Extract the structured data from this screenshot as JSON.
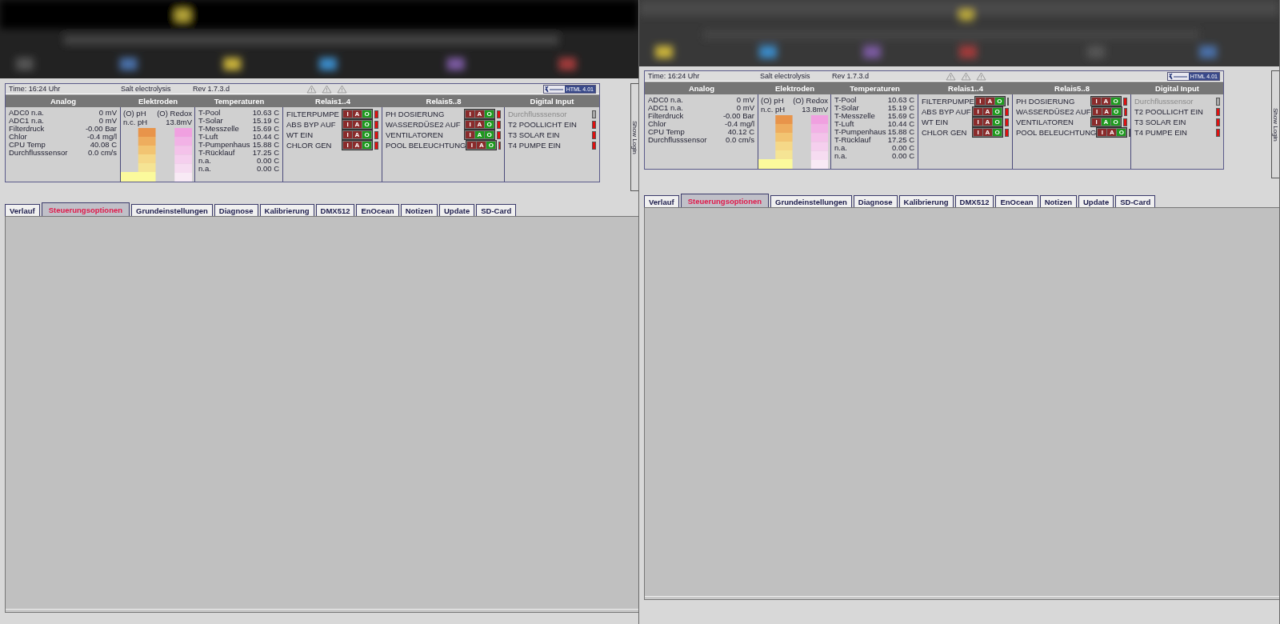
{
  "screens": [
    {
      "status": {
        "time": "Time: 16:24 Uhr",
        "mode": "Salt electrolysis",
        "rev": "Rev 1.7.3.d",
        "badge": "HTML 4.01"
      },
      "columns": [
        "Analog",
        "Elektroden",
        "Temperaturen",
        "Relais1..4",
        "Relais5..8",
        "Digital Input"
      ],
      "analog": [
        {
          "label": "ADC0 n.a.",
          "value": "0 mV"
        },
        {
          "label": "ADC1 n.a.",
          "value": "0 mV"
        },
        {
          "label": "Filterdruck",
          "value": "-0.00 Bar"
        },
        {
          "label": "Chlor",
          "value": "-0.4 mg/l"
        },
        {
          "label": "CPU Temp",
          "value": "40.08 C"
        },
        {
          "label": "Durchflusssensor",
          "value": "0.0 cm/s"
        }
      ],
      "electrodes": {
        "ph_label": "(O) pH",
        "redox_label": "(O) Redox",
        "ph_value": "n.c. pH",
        "redox_value": "13.8mV"
      },
      "temperatures": [
        {
          "label": "T-Pool",
          "value": "10.63 C"
        },
        {
          "label": "T-Solar",
          "value": "15.19 C"
        },
        {
          "label": "T-Messzelle",
          "value": "15.69 C"
        },
        {
          "label": "T-Luft",
          "value": "10.44 C"
        },
        {
          "label": "T-Pumpenhaus",
          "value": "15.88 C"
        },
        {
          "label": "T-Rücklauf",
          "value": "17.25 C"
        },
        {
          "label": "n.a.",
          "value": "0.00 C"
        },
        {
          "label": "n.a.",
          "value": "0.00 C"
        }
      ],
      "relays_1_4": [
        {
          "label": "FILTERPUMPE",
          "switch": [
            {
              "label": "I",
              "on": false
            },
            {
              "label": "A",
              "on": false
            },
            {
              "label": "O",
              "on": true
            }
          ]
        },
        {
          "label": "ABS BYP AUF",
          "switch": [
            {
              "label": "I",
              "on": false
            },
            {
              "label": "A",
              "on": false
            },
            {
              "label": "O",
              "on": true
            }
          ]
        },
        {
          "label": "WT EIN",
          "switch": [
            {
              "label": "I",
              "on": false
            },
            {
              "label": "A",
              "on": false
            },
            {
              "label": "O",
              "on": true
            }
          ]
        },
        {
          "label": "CHLOR GEN",
          "switch": [
            {
              "label": "I",
              "on": false
            },
            {
              "label": "A",
              "on": false
            },
            {
              "label": "O",
              "on": true
            }
          ]
        }
      ],
      "relays_5_8": [
        {
          "label": "PH DOSIERUNG",
          "switch": [
            {
              "label": "I",
              "on": false
            },
            {
              "label": "A",
              "on": false
            },
            {
              "label": "O",
              "on": true
            }
          ]
        },
        {
          "label": "WASSERDÜSE2 AUF",
          "switch": [
            {
              "label": "I",
              "on": false
            },
            {
              "label": "A",
              "on": false
            },
            {
              "label": "O",
              "on": true
            }
          ]
        },
        {
          "label": "VENTILATOREN",
          "switch": [
            {
              "label": "I",
              "on": false
            },
            {
              "label": "A",
              "on": true
            },
            {
              "label": "O",
              "on": true
            }
          ]
        },
        {
          "label": "POOL BELEUCHTUNG",
          "switch": [
            {
              "label": "I",
              "on": false
            },
            {
              "label": "A",
              "on": false
            },
            {
              "label": "O",
              "on": true
            }
          ]
        }
      ],
      "digital_inputs": [
        {
          "label": "Durchflusssensor",
          "active": false
        },
        {
          "label": "T2 POOLLICHT EIN",
          "active": true
        },
        {
          "label": "T3 SOLAR EIN",
          "active": true
        },
        {
          "label": "T4 PUMPE EIN",
          "active": true
        }
      ],
      "show_login": "Show Login",
      "tabs": [
        {
          "label": "Verlauf",
          "selected": false
        },
        {
          "label": "Steuerungsoptionen",
          "selected": true
        },
        {
          "label": "Grundeinstellungen",
          "selected": false
        },
        {
          "label": "Diagnose",
          "selected": false
        },
        {
          "label": "Kalibrierung",
          "selected": false
        },
        {
          "label": "DMX512",
          "selected": false
        },
        {
          "label": "EnOcean",
          "selected": false
        },
        {
          "label": "Notizen",
          "selected": false
        },
        {
          "label": "Update",
          "selected": false
        },
        {
          "label": "SD-Card",
          "selected": false
        }
      ]
    },
    {
      "status": {
        "time": "Time: 16:24 Uhr",
        "mode": "Salt electrolysis",
        "rev": "Rev 1.7.3.d",
        "badge": "HTML 4.01"
      },
      "columns": [
        "Analog",
        "Elektroden",
        "Temperaturen",
        "Relais1..4",
        "Relais5..8",
        "Digital Input"
      ],
      "analog": [
        {
          "label": "ADC0 n.a.",
          "value": "0 mV"
        },
        {
          "label": "ADC1 n.a.",
          "value": "0 mV"
        },
        {
          "label": "Filterdruck",
          "value": "-0.00 Bar"
        },
        {
          "label": "Chlor",
          "value": "-0.4 mg/l"
        },
        {
          "label": "CPU Temp",
          "value": "40.12 C"
        },
        {
          "label": "Durchflusssensor",
          "value": "0.0 cm/s"
        }
      ],
      "electrodes": {
        "ph_label": "(O) pH",
        "redox_label": "(O) Redox",
        "ph_value": "n.c. pH",
        "redox_value": "13.8mV"
      },
      "temperatures": [
        {
          "label": "T-Pool",
          "value": "10.63 C"
        },
        {
          "label": "T-Solar",
          "value": "15.19 C"
        },
        {
          "label": "T-Messzelle",
          "value": "15.69 C"
        },
        {
          "label": "T-Luft",
          "value": "10.44 C"
        },
        {
          "label": "T-Pumpenhaus",
          "value": "15.88 C"
        },
        {
          "label": "T-Rücklauf",
          "value": "17.25 C"
        },
        {
          "label": "n.a.",
          "value": "0.00 C"
        },
        {
          "label": "n.a.",
          "value": "0.00 C"
        }
      ],
      "relays_1_4": [
        {
          "label": "FILTERPUMPE",
          "switch": [
            {
              "label": "I",
              "on": false
            },
            {
              "label": "A",
              "on": false
            },
            {
              "label": "O",
              "on": true
            }
          ]
        },
        {
          "label": "ABS BYP AUF",
          "switch": [
            {
              "label": "I",
              "on": false
            },
            {
              "label": "A",
              "on": false
            },
            {
              "label": "O",
              "on": true
            }
          ]
        },
        {
          "label": "WT EIN",
          "switch": [
            {
              "label": "I",
              "on": false
            },
            {
              "label": "A",
              "on": false
            },
            {
              "label": "O",
              "on": true
            }
          ]
        },
        {
          "label": "CHLOR GEN",
          "switch": [
            {
              "label": "I",
              "on": false
            },
            {
              "label": "A",
              "on": false
            },
            {
              "label": "O",
              "on": true
            }
          ]
        }
      ],
      "relays_5_8": [
        {
          "label": "PH DOSIERUNG",
          "switch": [
            {
              "label": "I",
              "on": false
            },
            {
              "label": "A",
              "on": false
            },
            {
              "label": "O",
              "on": true
            }
          ]
        },
        {
          "label": "WASSERDÜSE2 AUF",
          "switch": [
            {
              "label": "I",
              "on": false
            },
            {
              "label": "A",
              "on": false
            },
            {
              "label": "O",
              "on": true
            }
          ]
        },
        {
          "label": "VENTILATOREN",
          "switch": [
            {
              "label": "I",
              "on": false
            },
            {
              "label": "A",
              "on": true
            },
            {
              "label": "O",
              "on": true
            }
          ]
        },
        {
          "label": "POOL BELEUCHTUNG",
          "switch": [
            {
              "label": "I",
              "on": false
            },
            {
              "label": "A",
              "on": false
            },
            {
              "label": "O",
              "on": true
            }
          ]
        }
      ],
      "digital_inputs": [
        {
          "label": "Durchflusssensor",
          "active": false
        },
        {
          "label": "T2 POOLLICHT EIN",
          "active": true
        },
        {
          "label": "T3 SOLAR EIN",
          "active": true
        },
        {
          "label": "T4 PUMPE EIN",
          "active": true
        }
      ],
      "show_login": "Show Login",
      "tabs": [
        {
          "label": "Verlauf",
          "selected": false
        },
        {
          "label": "Steuerungsoptionen",
          "selected": true
        },
        {
          "label": "Grundeinstellungen",
          "selected": false
        },
        {
          "label": "Diagnose",
          "selected": false
        },
        {
          "label": "Kalibrierung",
          "selected": false
        },
        {
          "label": "DMX512",
          "selected": false
        },
        {
          "label": "EnOcean",
          "selected": false
        },
        {
          "label": "Notizen",
          "selected": false
        },
        {
          "label": "Update",
          "selected": false
        },
        {
          "label": "SD-Card",
          "selected": false
        }
      ]
    }
  ]
}
